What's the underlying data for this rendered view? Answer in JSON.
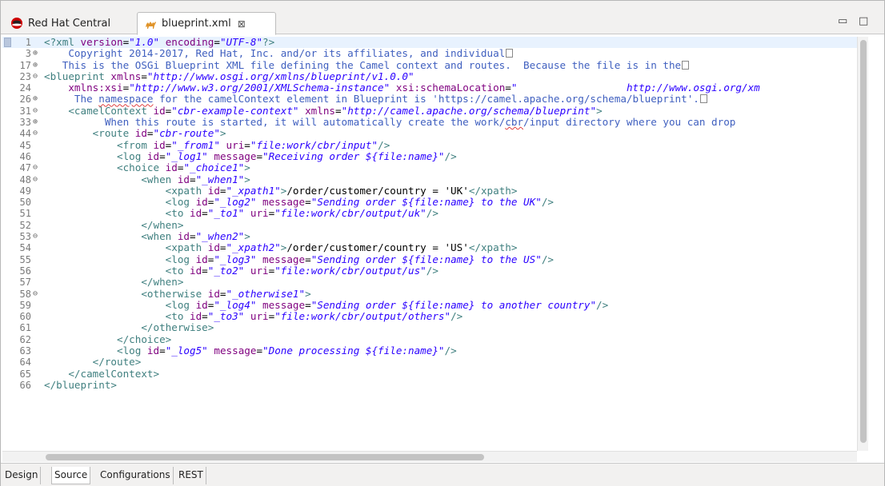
{
  "tabs": [
    {
      "label": "Red Hat Central",
      "icon": "redhat-icon",
      "active": false
    },
    {
      "label": "blueprint.xml",
      "icon": "camel-icon",
      "active": true,
      "close": "⊠"
    }
  ],
  "window_controls": {
    "minimize": "▭",
    "maximize": "□"
  },
  "bottom_tabs": [
    "Design",
    "Source",
    "Configurations",
    "REST"
  ],
  "active_bottom_tab": "Source",
  "lines": [
    {
      "num": "1",
      "fold": "",
      "segs": [
        [
          "proc",
          "<?xml "
        ],
        [
          "attr",
          "version"
        ],
        [
          "txt",
          "="
        ],
        [
          "val",
          "\"1.0\""
        ],
        [
          "txt",
          " "
        ],
        [
          "attr",
          "encoding"
        ],
        [
          "txt",
          "="
        ],
        [
          "val",
          "\"UTF-8\""
        ],
        [
          "proc",
          "?>"
        ]
      ]
    },
    {
      "num": "3",
      "fold": "⊕",
      "segs": [
        [
          "com",
          "    Copyright 2014-2017, Red Hat, Inc. and/or its affiliates, and individual"
        ],
        [
          "box",
          ""
        ]
      ]
    },
    {
      "num": "17",
      "fold": "⊕",
      "segs": [
        [
          "com",
          "   This is the OSGi Blueprint XML file defining the Camel context and routes.  Because the file is in the"
        ],
        [
          "box",
          ""
        ]
      ]
    },
    {
      "num": "23",
      "fold": "⊖",
      "segs": [
        [
          "tag",
          "<blueprint "
        ],
        [
          "attr",
          "xmlns"
        ],
        [
          "txt",
          "="
        ],
        [
          "val",
          "\"http://www.osgi.org/xmlns/blueprint/v1.0.0\""
        ]
      ]
    },
    {
      "num": "24",
      "fold": "",
      "segs": [
        [
          "txt",
          "    "
        ],
        [
          "attr",
          "xmlns:xsi"
        ],
        [
          "txt",
          "="
        ],
        [
          "val",
          "\"http://www.w3.org/2001/XMLSchema-instance\""
        ],
        [
          "txt",
          " "
        ],
        [
          "attr",
          "xsi:schemaLocation"
        ],
        [
          "txt",
          "="
        ],
        [
          "val",
          "\"                  http://www.osgi.org/xm"
        ]
      ]
    },
    {
      "num": "26",
      "fold": "⊕",
      "segs": [
        [
          "com",
          "     The "
        ],
        [
          "comsq",
          "namespace"
        ],
        [
          "com",
          " for the camelContext element in Blueprint is 'https://camel.apache.org/schema/blueprint'."
        ],
        [
          "box",
          ""
        ]
      ]
    },
    {
      "num": "31",
      "fold": "⊖",
      "segs": [
        [
          "txt",
          "    "
        ],
        [
          "tag",
          "<camelContext "
        ],
        [
          "attr",
          "id"
        ],
        [
          "txt",
          "="
        ],
        [
          "val",
          "\"cbr-example-context\""
        ],
        [
          "txt",
          " "
        ],
        [
          "attr",
          "xmlns"
        ],
        [
          "txt",
          "="
        ],
        [
          "val",
          "\"http://camel.apache.org/schema/blueprint\""
        ],
        [
          "tag",
          ">"
        ]
      ]
    },
    {
      "num": "33",
      "fold": "⊕",
      "segs": [
        [
          "com",
          "          When this route is started, it will automatically create the work/"
        ],
        [
          "comsq",
          "cbr"
        ],
        [
          "com",
          "/input directory where you can drop"
        ]
      ]
    },
    {
      "num": "44",
      "fold": "⊖",
      "segs": [
        [
          "txt",
          "        "
        ],
        [
          "tag",
          "<route "
        ],
        [
          "attr",
          "id"
        ],
        [
          "txt",
          "="
        ],
        [
          "val",
          "\"cbr-route\""
        ],
        [
          "tag",
          ">"
        ]
      ]
    },
    {
      "num": "45",
      "fold": "",
      "segs": [
        [
          "txt",
          "            "
        ],
        [
          "tag",
          "<from "
        ],
        [
          "attr",
          "id"
        ],
        [
          "txt",
          "="
        ],
        [
          "val",
          "\"_from1\""
        ],
        [
          "txt",
          " "
        ],
        [
          "attr",
          "uri"
        ],
        [
          "txt",
          "="
        ],
        [
          "val",
          "\"file:work/cbr/input\""
        ],
        [
          "tag",
          "/>"
        ]
      ]
    },
    {
      "num": "46",
      "fold": "",
      "segs": [
        [
          "txt",
          "            "
        ],
        [
          "tag",
          "<log "
        ],
        [
          "attr",
          "id"
        ],
        [
          "txt",
          "="
        ],
        [
          "val",
          "\"_log1\""
        ],
        [
          "txt",
          " "
        ],
        [
          "attr",
          "message"
        ],
        [
          "txt",
          "="
        ],
        [
          "val",
          "\"Receiving order ${file:name}\""
        ],
        [
          "tag",
          "/>"
        ]
      ]
    },
    {
      "num": "47",
      "fold": "⊖",
      "segs": [
        [
          "txt",
          "            "
        ],
        [
          "tag",
          "<choice "
        ],
        [
          "attr",
          "id"
        ],
        [
          "txt",
          "="
        ],
        [
          "val",
          "\"_choice1\""
        ],
        [
          "tag",
          ">"
        ]
      ]
    },
    {
      "num": "48",
      "fold": "⊖",
      "segs": [
        [
          "txt",
          "                "
        ],
        [
          "tag",
          "<when "
        ],
        [
          "attr",
          "id"
        ],
        [
          "txt",
          "="
        ],
        [
          "val",
          "\"_when1\""
        ],
        [
          "tag",
          ">"
        ]
      ]
    },
    {
      "num": "49",
      "fold": "",
      "segs": [
        [
          "txt",
          "                    "
        ],
        [
          "tag",
          "<xpath "
        ],
        [
          "attr",
          "id"
        ],
        [
          "txt",
          "="
        ],
        [
          "val",
          "\"_xpath1\""
        ],
        [
          "tag",
          ">"
        ],
        [
          "txt",
          "/order/customer/country = 'UK'"
        ],
        [
          "tag",
          "</xpath>"
        ]
      ]
    },
    {
      "num": "50",
      "fold": "",
      "segs": [
        [
          "txt",
          "                    "
        ],
        [
          "tag",
          "<log "
        ],
        [
          "attr",
          "id"
        ],
        [
          "txt",
          "="
        ],
        [
          "val",
          "\"_log2\""
        ],
        [
          "txt",
          " "
        ],
        [
          "attr",
          "message"
        ],
        [
          "txt",
          "="
        ],
        [
          "val",
          "\"Sending order ${file:name} to the UK\""
        ],
        [
          "tag",
          "/>"
        ]
      ]
    },
    {
      "num": "51",
      "fold": "",
      "segs": [
        [
          "txt",
          "                    "
        ],
        [
          "tag",
          "<to "
        ],
        [
          "attr",
          "id"
        ],
        [
          "txt",
          "="
        ],
        [
          "val",
          "\"_to1\""
        ],
        [
          "txt",
          " "
        ],
        [
          "attr",
          "uri"
        ],
        [
          "txt",
          "="
        ],
        [
          "val",
          "\"file:work/cbr/output/uk\""
        ],
        [
          "tag",
          "/>"
        ]
      ]
    },
    {
      "num": "52",
      "fold": "",
      "segs": [
        [
          "txt",
          "                "
        ],
        [
          "tag",
          "</when>"
        ]
      ]
    },
    {
      "num": "53",
      "fold": "⊖",
      "segs": [
        [
          "txt",
          "                "
        ],
        [
          "tag",
          "<when "
        ],
        [
          "attr",
          "id"
        ],
        [
          "txt",
          "="
        ],
        [
          "val",
          "\"_when2\""
        ],
        [
          "tag",
          ">"
        ]
      ]
    },
    {
      "num": "54",
      "fold": "",
      "segs": [
        [
          "txt",
          "                    "
        ],
        [
          "tag",
          "<xpath "
        ],
        [
          "attr",
          "id"
        ],
        [
          "txt",
          "="
        ],
        [
          "val",
          "\"_xpath2\""
        ],
        [
          "tag",
          ">"
        ],
        [
          "txt",
          "/order/customer/country = 'US'"
        ],
        [
          "tag",
          "</xpath>"
        ]
      ]
    },
    {
      "num": "55",
      "fold": "",
      "segs": [
        [
          "txt",
          "                    "
        ],
        [
          "tag",
          "<log "
        ],
        [
          "attr",
          "id"
        ],
        [
          "txt",
          "="
        ],
        [
          "val",
          "\"_log3\""
        ],
        [
          "txt",
          " "
        ],
        [
          "attr",
          "message"
        ],
        [
          "txt",
          "="
        ],
        [
          "val",
          "\"Sending order ${file:name} to the US\""
        ],
        [
          "tag",
          "/>"
        ]
      ]
    },
    {
      "num": "56",
      "fold": "",
      "segs": [
        [
          "txt",
          "                    "
        ],
        [
          "tag",
          "<to "
        ],
        [
          "attr",
          "id"
        ],
        [
          "txt",
          "="
        ],
        [
          "val",
          "\"_to2\""
        ],
        [
          "txt",
          " "
        ],
        [
          "attr",
          "uri"
        ],
        [
          "txt",
          "="
        ],
        [
          "val",
          "\"file:work/cbr/output/us\""
        ],
        [
          "tag",
          "/>"
        ]
      ]
    },
    {
      "num": "57",
      "fold": "",
      "segs": [
        [
          "txt",
          "                "
        ],
        [
          "tag",
          "</when>"
        ]
      ]
    },
    {
      "num": "58",
      "fold": "⊖",
      "segs": [
        [
          "txt",
          "                "
        ],
        [
          "tag",
          "<otherwise "
        ],
        [
          "attr",
          "id"
        ],
        [
          "txt",
          "="
        ],
        [
          "val",
          "\"_otherwise1\""
        ],
        [
          "tag",
          ">"
        ]
      ]
    },
    {
      "num": "59",
      "fold": "",
      "segs": [
        [
          "txt",
          "                    "
        ],
        [
          "tag",
          "<log "
        ],
        [
          "attr",
          "id"
        ],
        [
          "txt",
          "="
        ],
        [
          "val",
          "\"_log4\""
        ],
        [
          "txt",
          " "
        ],
        [
          "attr",
          "message"
        ],
        [
          "txt",
          "="
        ],
        [
          "val",
          "\"Sending order ${file:name} to another country\""
        ],
        [
          "tag",
          "/>"
        ]
      ]
    },
    {
      "num": "60",
      "fold": "",
      "segs": [
        [
          "txt",
          "                    "
        ],
        [
          "tag",
          "<to "
        ],
        [
          "attr",
          "id"
        ],
        [
          "txt",
          "="
        ],
        [
          "val",
          "\"_to3\""
        ],
        [
          "txt",
          " "
        ],
        [
          "attr",
          "uri"
        ],
        [
          "txt",
          "="
        ],
        [
          "val",
          "\"file:work/cbr/output/others\""
        ],
        [
          "tag",
          "/>"
        ]
      ]
    },
    {
      "num": "61",
      "fold": "",
      "segs": [
        [
          "txt",
          "                "
        ],
        [
          "tag",
          "</otherwise>"
        ]
      ]
    },
    {
      "num": "62",
      "fold": "",
      "segs": [
        [
          "txt",
          "            "
        ],
        [
          "tag",
          "</choice>"
        ]
      ]
    },
    {
      "num": "63",
      "fold": "",
      "segs": [
        [
          "txt",
          "            "
        ],
        [
          "tag",
          "<log "
        ],
        [
          "attr",
          "id"
        ],
        [
          "txt",
          "="
        ],
        [
          "val",
          "\"_log5\""
        ],
        [
          "txt",
          " "
        ],
        [
          "attr",
          "message"
        ],
        [
          "txt",
          "="
        ],
        [
          "val",
          "\"Done processing ${file:name}\""
        ],
        [
          "tag",
          "/>"
        ]
      ]
    },
    {
      "num": "64",
      "fold": "",
      "segs": [
        [
          "txt",
          "        "
        ],
        [
          "tag",
          "</route>"
        ]
      ]
    },
    {
      "num": "65",
      "fold": "",
      "segs": [
        [
          "txt",
          "    "
        ],
        [
          "tag",
          "</camelContext>"
        ]
      ]
    },
    {
      "num": "66",
      "fold": "",
      "segs": [
        [
          "tag",
          "</blueprint>"
        ]
      ]
    }
  ],
  "colors": {
    "tag": "#3f7f7f",
    "attr": "#7f007f",
    "value": "#2a00ff",
    "comment": "#3f5fbf",
    "current_line": "#e8f2fe"
  }
}
